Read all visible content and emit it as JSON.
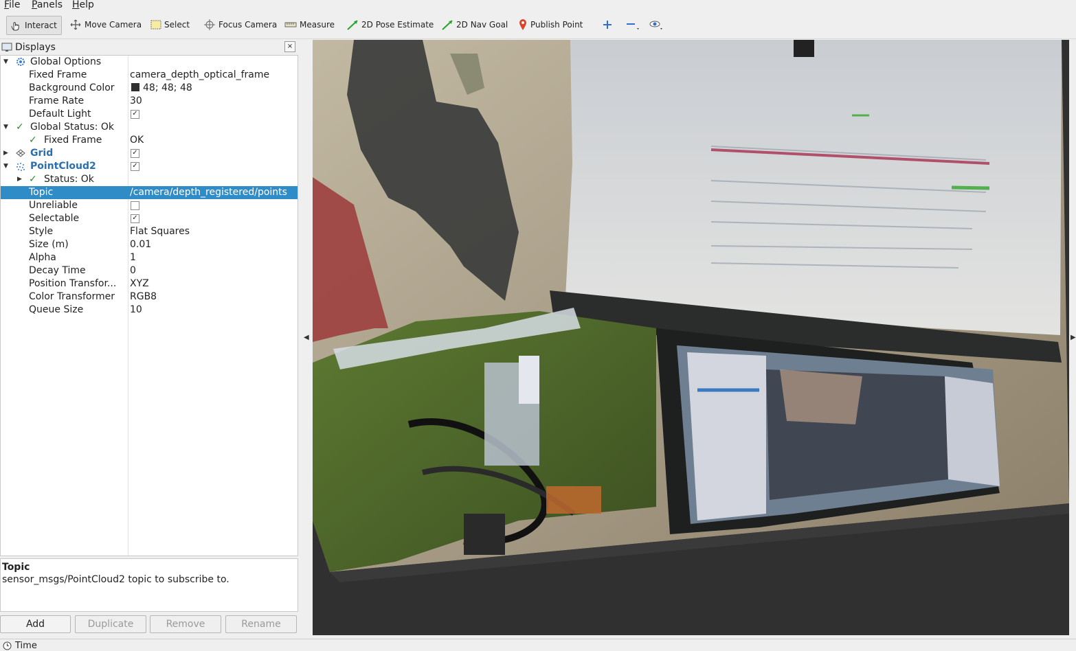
{
  "menu": {
    "file": "File",
    "panels": "Panels",
    "help": "Help"
  },
  "toolbar": {
    "interact": "Interact",
    "move_camera": "Move Camera",
    "select": "Select",
    "focus_camera": "Focus Camera",
    "measure": "Measure",
    "pose_estimate": "2D Pose Estimate",
    "nav_goal": "2D Nav Goal",
    "publish_point": "Publish Point"
  },
  "displays_panel": {
    "title": "Displays",
    "close": "×",
    "rows": {
      "global_options": "Global Options",
      "fixed_frame_label": "Fixed Frame",
      "fixed_frame_value": "camera_depth_optical_frame",
      "bg_color_label": "Background Color",
      "bg_color_value": "48; 48; 48",
      "frame_rate_label": "Frame Rate",
      "frame_rate_value": "30",
      "default_light_label": "Default Light",
      "global_status_label": "Global Status: Ok",
      "status_fixed_frame_label": "Fixed Frame",
      "status_fixed_frame_value": "OK",
      "grid_label": "Grid",
      "pointcloud_label": "PointCloud2",
      "pc_status_label": "Status: Ok",
      "topic_label": "Topic",
      "topic_value": "/camera/depth_registered/points",
      "unreliable_label": "Unreliable",
      "selectable_label": "Selectable",
      "style_label": "Style",
      "style_value": "Flat Squares",
      "size_label": "Size (m)",
      "size_value": "0.01",
      "alpha_label": "Alpha",
      "alpha_value": "1",
      "decay_label": "Decay Time",
      "decay_value": "0",
      "position_transformer_label": "Position Transfor...",
      "position_transformer_value": "XYZ",
      "color_transformer_label": "Color Transformer",
      "color_transformer_value": "RGB8",
      "queue_size_label": "Queue Size",
      "queue_size_value": "10"
    },
    "checkboxes": {
      "default_light": true,
      "grid": true,
      "pointcloud": true,
      "unreliable": false,
      "selectable": true
    }
  },
  "description": {
    "title": "Topic",
    "text": "sensor_msgs/PointCloud2 topic to subscribe to."
  },
  "buttons": {
    "add": "Add",
    "duplicate": "Duplicate",
    "remove": "Remove",
    "rename": "Rename"
  },
  "status_bar": {
    "time": "Time"
  },
  "colors": {
    "selection": "#308cc6",
    "viewport_bg": "#303030",
    "ok_check": "#2e8b2e"
  },
  "icons": [
    "interact-icon",
    "move-camera-icon",
    "select-icon",
    "focus-camera-icon",
    "measure-icon",
    "pose-estimate-icon",
    "nav-goal-icon",
    "publish-point-icon",
    "plus-icon",
    "minus-icon",
    "eye-icon",
    "displays-icon",
    "clock-icon"
  ]
}
